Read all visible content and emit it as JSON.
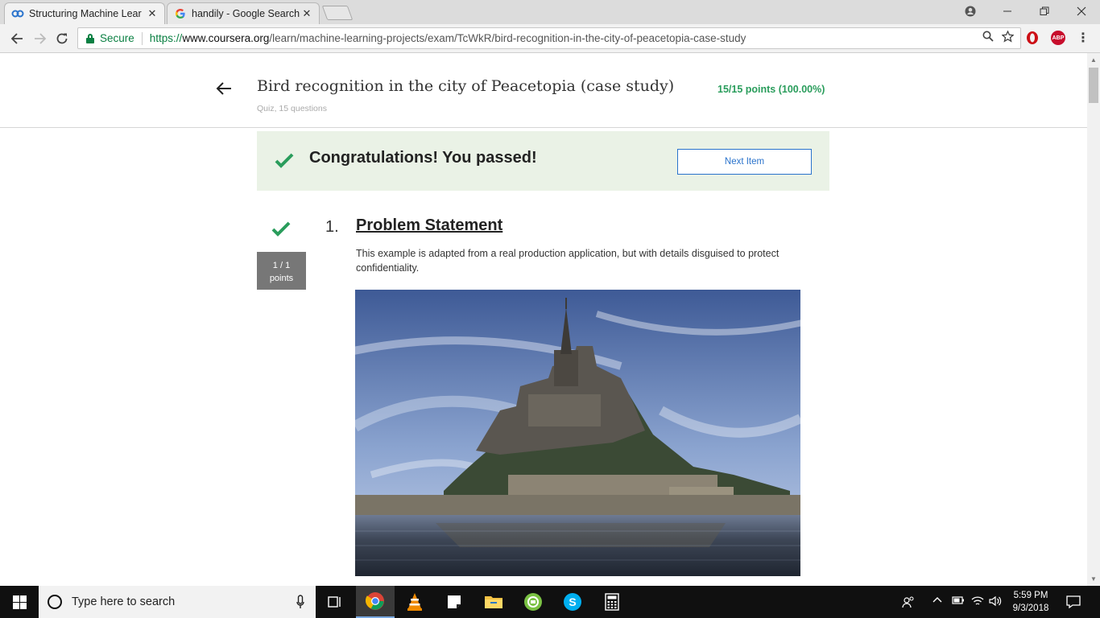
{
  "browser": {
    "tabs": [
      {
        "title": "Structuring Machine Lear",
        "favicon": "coursera-icon",
        "active": true
      },
      {
        "title": "handily - Google Search",
        "favicon": "google-icon",
        "active": false
      }
    ],
    "address": {
      "secure_label": "Secure",
      "url_scheme": "https://",
      "url_host": "www.coursera.org",
      "url_path": "/learn/machine-learning-projects/exam/TcWkR/bird-recognition-in-the-city-of-peacetopia-case-study"
    },
    "extensions": [
      "opera-icon",
      "adblock-icon"
    ],
    "adblock_label": "ABP"
  },
  "header": {
    "title": "Bird recognition in the city of Peacetopia (case study)",
    "subtitle": "Quiz, 15 questions",
    "score": "15/15 points (100.00%)"
  },
  "banner": {
    "message": "Congratulations! You passed!",
    "next_button": "Next Item"
  },
  "question": {
    "number": "1.",
    "title": "Problem Statement",
    "points_line1": "1 / 1",
    "points_line2": "points",
    "body": "This example is adapted from a real production application, but with details disguised to protect confidentiality."
  },
  "taskbar": {
    "search_placeholder": "Type here to search",
    "time": "5:59 PM",
    "date": "9/3/2018",
    "pinned": [
      "task-view-icon",
      "chrome-icon",
      "vlc-icon",
      "sticky-notes-icon",
      "file-explorer-icon",
      "green-app-icon",
      "skype-icon",
      "calculator-icon"
    ]
  },
  "colors": {
    "accent_green": "#2a9d5c",
    "banner_bg": "#eaf2e6",
    "link_blue": "#2a73cc"
  }
}
